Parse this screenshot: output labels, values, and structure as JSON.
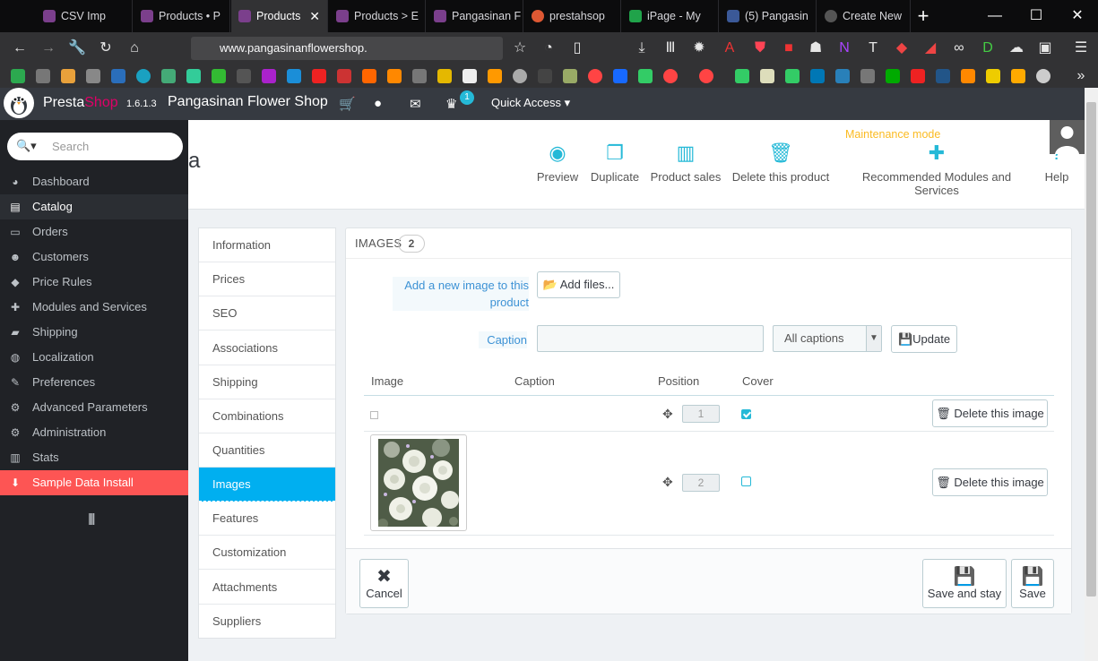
{
  "browser": {
    "tabs": [
      {
        "label": "CSV Imp",
        "color": "#7b3f8c"
      },
      {
        "label": "Products • P",
        "color": "#7b3f8c"
      },
      {
        "label": "Products",
        "color": "#7b3f8c"
      },
      {
        "label": "Products > E",
        "color": "#7b3f8c"
      },
      {
        "label": "Pangasinan F",
        "color": "#7b3f8c"
      },
      {
        "label": "prestahsop",
        "color": "#de5833"
      },
      {
        "label": "iPage - My",
        "color": "#20a34a"
      },
      {
        "label": "(5) Pangasin",
        "color": "#3b5998"
      },
      {
        "label": "Create New",
        "color": "#555555"
      }
    ],
    "new_tab": "+",
    "url": "www.pangasinanflowershop.",
    "url_dots": "•••",
    "window_min": "—",
    "window_max": "☐",
    "window_close": "✕"
  },
  "admin_header": {
    "brand_presta": "Presta",
    "brand_shop": "Shop",
    "version": "1.6.1.3",
    "shop_name": "Pangasinan Flower Shop",
    "notif_count": "1",
    "quick_access": "Quick Access ▾"
  },
  "sidebar": {
    "search_placeholder": "Search",
    "items": [
      {
        "label": "Dashboard",
        "icon": "◕"
      },
      {
        "label": "Catalog",
        "icon": "▤"
      },
      {
        "label": "Orders",
        "icon": "▭"
      },
      {
        "label": "Customers",
        "icon": "☻"
      },
      {
        "label": "Price Rules",
        "icon": "◆"
      },
      {
        "label": "Modules and Services",
        "icon": "✚"
      },
      {
        "label": "Shipping",
        "icon": "▰"
      },
      {
        "label": "Localization",
        "icon": "◍"
      },
      {
        "label": "Preferences",
        "icon": "✎"
      },
      {
        "label": "Advanced Parameters",
        "icon": "⚙"
      },
      {
        "label": "Administration",
        "icon": "⚙"
      },
      {
        "label": "Stats",
        "icon": "▥"
      },
      {
        "label": "Sample Data Install",
        "icon": "⬇"
      }
    ],
    "collapse_icon": "||||"
  },
  "toolbar": {
    "title_fragment": "a",
    "maintenance": "Maintenance mode",
    "buttons": [
      {
        "label": "Preview",
        "icon": "◉"
      },
      {
        "label": "Duplicate",
        "icon": "❐"
      },
      {
        "label": "Product sales",
        "icon": "▥"
      },
      {
        "label": "Delete this product",
        "icon": "🗑"
      },
      {
        "label": "Recommended Modules and Services",
        "icon": "✚"
      },
      {
        "label": "Help",
        "icon": "?"
      }
    ]
  },
  "product_tabs": [
    "Information",
    "Prices",
    "SEO",
    "Associations",
    "Shipping",
    "Combinations",
    "Quantities",
    "Images",
    "Features",
    "Customization",
    "Attachments",
    "Suppliers"
  ],
  "images_panel": {
    "heading": "IMAGES",
    "count": "2",
    "add_label": "Add a new image to this product",
    "add_button": "Add files...",
    "caption_label": "Caption",
    "caption_value": "",
    "caption_select": "All captions",
    "update_button": "Update",
    "columns": [
      "Image",
      "Caption",
      "Position",
      "Cover"
    ],
    "rows": [
      {
        "position": "1",
        "cover": true,
        "delete": "Delete this image"
      },
      {
        "position": "2",
        "cover": false,
        "delete": "Delete this image"
      }
    ],
    "cancel": "Cancel",
    "save_and_stay": "Save and stay",
    "save": "Save"
  }
}
